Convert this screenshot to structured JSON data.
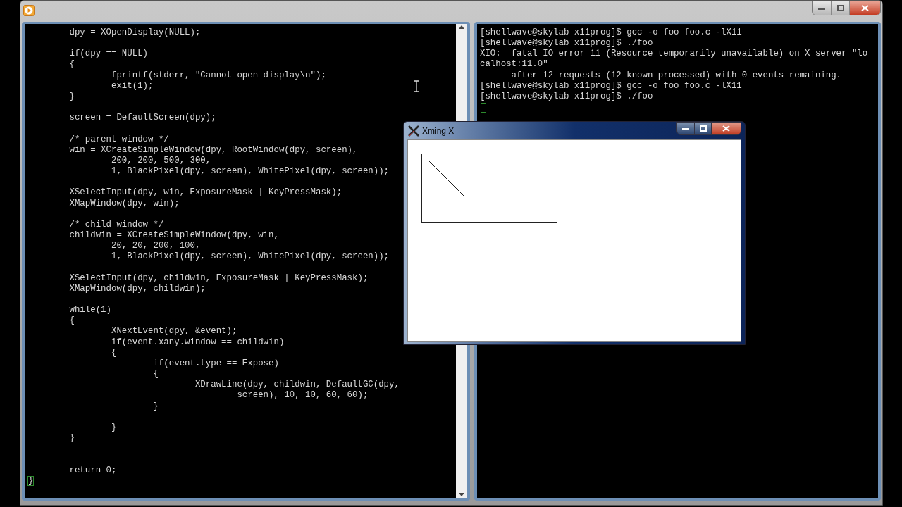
{
  "editor": {
    "lines": [
      {
        "kind": "spaced",
        "text": "        dpy = XOpenDisplay(NULL);",
        "cursor": false
      },
      {
        "kind": "plain",
        "text": "        if(dpy == NULL)",
        "cursor": false
      },
      {
        "kind": "plain",
        "text": "        {",
        "cursor": false
      },
      {
        "kind": "plain",
        "text": "                fprintf(stderr, \"Cannot open display\\n\");",
        "cursor": false
      },
      {
        "kind": "plain",
        "text": "                exit(1);",
        "cursor": false
      },
      {
        "kind": "spaced",
        "text": "        }",
        "cursor": false
      },
      {
        "kind": "spaced",
        "text": "        screen = DefaultScreen(dpy);",
        "cursor": false
      },
      {
        "kind": "plain",
        "text": "        /* parent window */",
        "cursor": false
      },
      {
        "kind": "plain",
        "text": "        win = XCreateSimpleWindow(dpy, RootWindow(dpy, screen),",
        "cursor": false
      },
      {
        "kind": "plain",
        "text": "                200, 200, 500, 300,",
        "cursor": false
      },
      {
        "kind": "spaced",
        "text": "                1, BlackPixel(dpy, screen), WhitePixel(dpy, screen));",
        "cursor": false
      },
      {
        "kind": "plain",
        "text": "        XSelectInput(dpy, win, ExposureMask | KeyPressMask);",
        "cursor": false
      },
      {
        "kind": "spaced",
        "text": "        XMapWindow(dpy, win);",
        "cursor": false
      },
      {
        "kind": "plain",
        "text": "        /* child window */",
        "cursor": false
      },
      {
        "kind": "plain",
        "text": "        childwin = XCreateSimpleWindow(dpy, win,",
        "cursor": false
      },
      {
        "kind": "plain",
        "text": "                20, 20, 200, 100,",
        "cursor": false
      },
      {
        "kind": "spaced",
        "text": "                1, BlackPixel(dpy, screen), WhitePixel(dpy, screen));",
        "cursor": false
      },
      {
        "kind": "plain",
        "text": "        XSelectInput(dpy, childwin, ExposureMask | KeyPressMask);",
        "cursor": false
      },
      {
        "kind": "spaced",
        "text": "        XMapWindow(dpy, childwin);",
        "cursor": false
      },
      {
        "kind": "plain",
        "text": "        while(1)",
        "cursor": false
      },
      {
        "kind": "plain",
        "text": "        {",
        "cursor": false
      },
      {
        "kind": "plain",
        "text": "                XNextEvent(dpy, &event);",
        "cursor": false
      },
      {
        "kind": "plain",
        "text": "                if(event.xany.window == childwin)",
        "cursor": false
      },
      {
        "kind": "plain",
        "text": "                {",
        "cursor": false
      },
      {
        "kind": "plain",
        "text": "                        if(event.type == Expose)",
        "cursor": false
      },
      {
        "kind": "plain",
        "text": "                        {",
        "cursor": false
      },
      {
        "kind": "plain",
        "text": "                                XDrawLine(dpy, childwin, DefaultGC(dpy,",
        "cursor": false
      },
      {
        "kind": "plain",
        "text": "                                        screen), 10, 10, 60, 60);",
        "cursor": false
      },
      {
        "kind": "spaced",
        "text": "                        }",
        "cursor": false
      },
      {
        "kind": "plain",
        "text": "                }",
        "cursor": false
      },
      {
        "kind": "doublespaced",
        "text": "        }",
        "cursor": false
      },
      {
        "kind": "plain",
        "text": "        return 0;",
        "cursor": false
      },
      {
        "kind": "plain",
        "text": "}",
        "cursor": true
      }
    ]
  },
  "terminal": {
    "lines": [
      "[shellwave@skylab x11prog]$ gcc -o foo foo.c -lX11",
      "[shellwave@skylab x11prog]$ ./foo",
      "XIO:  fatal IO error 11 (Resource temporarily unavailable) on X server \"lo",
      "calhost:11.0\"",
      "      after 12 requests (12 known processed) with 0 events remaining.",
      "[shellwave@skylab x11prog]$ gcc -o foo foo.c -lX11",
      "[shellwave@skylab x11prog]$ ./foo"
    ]
  },
  "xming_window": {
    "title": "Xming X"
  }
}
